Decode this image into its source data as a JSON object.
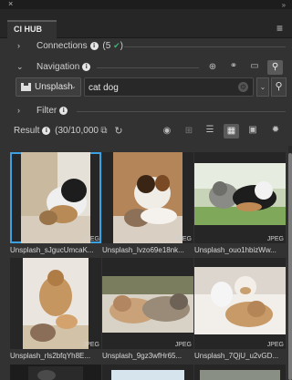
{
  "window": {
    "close_glyph": "×",
    "grip_glyph": "››"
  },
  "panel": {
    "tab_title": "CI HUB",
    "menu_glyph": "≡"
  },
  "connections": {
    "label": "Connections",
    "count": "(5",
    "close_paren": ")",
    "status_color": "#3cb371"
  },
  "navigation": {
    "label": "Navigation",
    "icons": [
      "zoom-in-icon",
      "link-icon",
      "folder-icon",
      "search-icon"
    ]
  },
  "search": {
    "source": "Unsplash",
    "query": "cat dog"
  },
  "filter": {
    "label": "Filter"
  },
  "result": {
    "label": "Result",
    "count": "(30/10,000",
    "view_icons": [
      "eye-icon",
      "cart-icon",
      "list-view-icon",
      "grid-view-icon",
      "details-view-icon",
      "settings-icon"
    ],
    "active_view": "grid-view-icon"
  },
  "assets": [
    {
      "name": "Unsplash_sJgucUmcaK...",
      "badge": "JPEG",
      "selected": true
    },
    {
      "name": "Unsplash_Ivzo69e18nk...",
      "badge": "JPEG",
      "selected": false
    },
    {
      "name": "Unsplash_ouo1hbizWw...",
      "badge": "JPEG",
      "selected": false
    },
    {
      "name": "Unsplash_rls2bfqYh8E...",
      "badge": "JPEG",
      "selected": false
    },
    {
      "name": "Unsplash_9gz3wfHr65...",
      "badge": "JPEG",
      "selected": false
    },
    {
      "name": "Unsplash_7QjU_u2vGD...",
      "badge": "JPEG",
      "selected": false
    }
  ],
  "colors": {
    "panel_bg": "#323232",
    "selection": "#3ea0e0"
  }
}
